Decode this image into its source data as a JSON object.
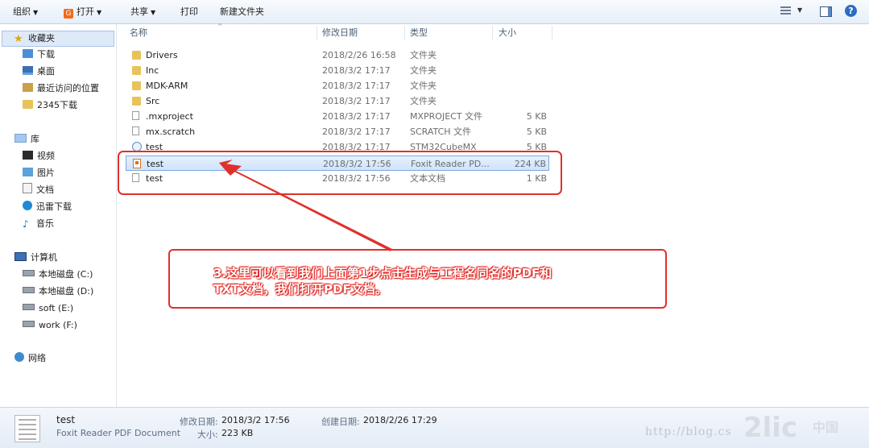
{
  "toolbar": {
    "organize": "组织",
    "open": "打开",
    "share": "共享",
    "print": "打印",
    "new_folder": "新建文件夹"
  },
  "sidebar": {
    "favorites": "收藏夹",
    "downloads": "下载",
    "desktop": "桌面",
    "recent": "最近访问的位置",
    "dl2345": "2345下载",
    "libraries": "库",
    "videos": "视频",
    "pictures": "图片",
    "documents": "文档",
    "xunlei": "迅雷下载",
    "music": "音乐",
    "computer": "计算机",
    "disk_c": "本地磁盘 (C:)",
    "disk_d": "本地磁盘 (D:)",
    "disk_e": "soft (E:)",
    "disk_f": "work (F:)",
    "network": "网络"
  },
  "columns": {
    "name": "名称",
    "date": "修改日期",
    "type": "类型",
    "size": "大小"
  },
  "files": [
    {
      "name": "Drivers",
      "date": "2018/2/26 16:58",
      "type": "文件夹",
      "size": ""
    },
    {
      "name": "Inc",
      "date": "2018/3/2 17:17",
      "type": "文件夹",
      "size": ""
    },
    {
      "name": "MDK-ARM",
      "date": "2018/3/2 17:17",
      "type": "文件夹",
      "size": ""
    },
    {
      "name": "Src",
      "date": "2018/3/2 17:17",
      "type": "文件夹",
      "size": ""
    },
    {
      "name": ".mxproject",
      "date": "2018/3/2 17:17",
      "type": "MXPROJECT 文件",
      "size": "5 KB"
    },
    {
      "name": "mx.scratch",
      "date": "2018/3/2 17:17",
      "type": "SCRATCH 文件",
      "size": "5 KB"
    },
    {
      "name": "test",
      "date": "2018/3/2 17:17",
      "type": "STM32CubeMX",
      "size": "5 KB"
    },
    {
      "name": "test",
      "date": "2018/3/2 17:56",
      "type": "Foxit Reader PD...",
      "size": "224 KB"
    },
    {
      "name": "test",
      "date": "2018/3/2 17:56",
      "type": "文本文档",
      "size": "1 KB"
    }
  ],
  "annotation": {
    "line1": "3.这里可以看到我们上面第1步点击生成与工程名同名的PDF和",
    "line2": "TXT文档，我们打开PDF文档。"
  },
  "details": {
    "name": "test",
    "type": "Foxit Reader PDF Document",
    "modified_label": "修改日期:",
    "modified": "2018/3/2 17:56",
    "created_label": "创建日期:",
    "created": "2018/2/26 17:29",
    "size_label": "大小:",
    "size": "223 KB"
  },
  "watermark": "http://blog.cs"
}
